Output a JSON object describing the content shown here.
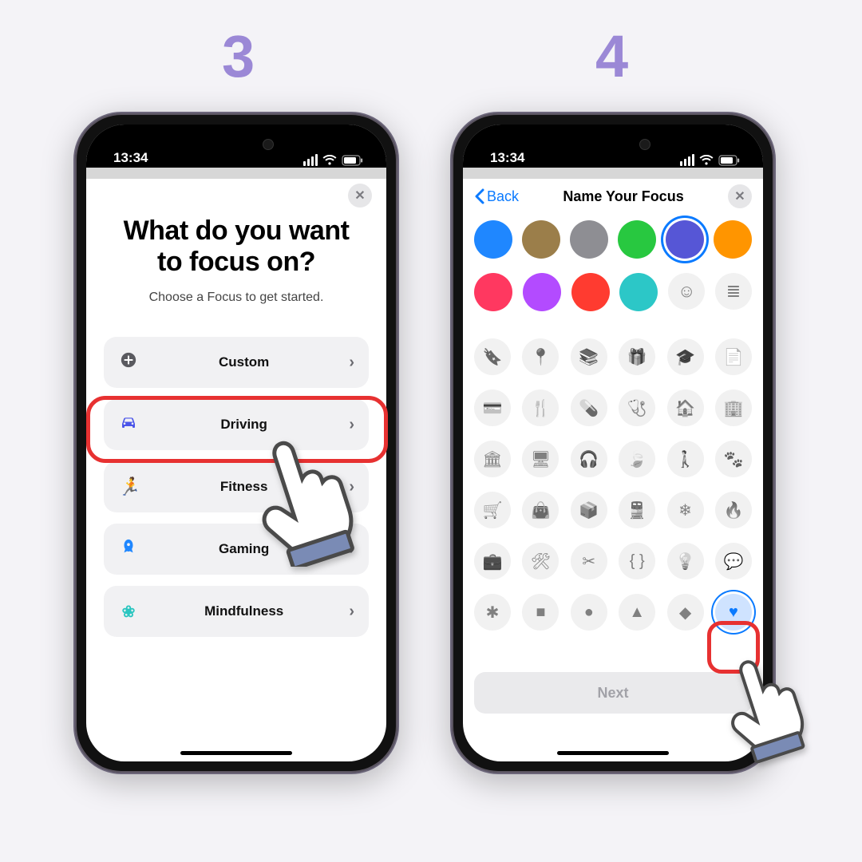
{
  "steps": {
    "left_num": "3",
    "right_num": "4"
  },
  "statusbar": {
    "time": "13:34"
  },
  "screen1": {
    "title": "What do you want to focus on?",
    "subtitle": "Choose a Focus to get started.",
    "options": [
      {
        "id": "custom",
        "label": "Custom",
        "icon": "plus-circle",
        "color": "#5a5a5f",
        "highlighted": true
      },
      {
        "id": "driving",
        "label": "Driving",
        "icon": "car",
        "color": "#4b55e9"
      },
      {
        "id": "fitness",
        "label": "Fitness",
        "icon": "runner",
        "color": "#2fbf63"
      },
      {
        "id": "gaming",
        "label": "Gaming",
        "icon": "rocket",
        "color": "#1f87ff"
      },
      {
        "id": "mindfulness",
        "label": "Mindfulness",
        "icon": "flower",
        "color": "#2bc6c0"
      }
    ]
  },
  "screen2": {
    "back_label": "Back",
    "title": "Name Your Focus",
    "next_label": "Next",
    "selected_color_index": 4,
    "selected_icon_index": 41,
    "colors": [
      "#1f87ff",
      "#9b7e4a",
      "#8e8e93",
      "#28c840",
      "#5656d6",
      "#ff9500",
      "#ff3860",
      "#b34bff",
      "#ff3b30",
      "#2cc7c7"
    ],
    "emoji_button": "emoji",
    "list_button": "list",
    "icons": [
      "bookmark",
      "pin",
      "books",
      "gift",
      "grad-cap",
      "document",
      "credit-card",
      "utensils",
      "pills",
      "stethoscope",
      "home",
      "building",
      "bank",
      "display",
      "headphones",
      "leaf",
      "person",
      "paw",
      "cart",
      "bag",
      "box",
      "train",
      "snowflake",
      "flame",
      "briefcase",
      "tools",
      "scissors",
      "braces",
      "lightbulb",
      "speech",
      "asterisk",
      "square",
      "circle",
      "triangle",
      "diamond",
      "heart"
    ]
  }
}
